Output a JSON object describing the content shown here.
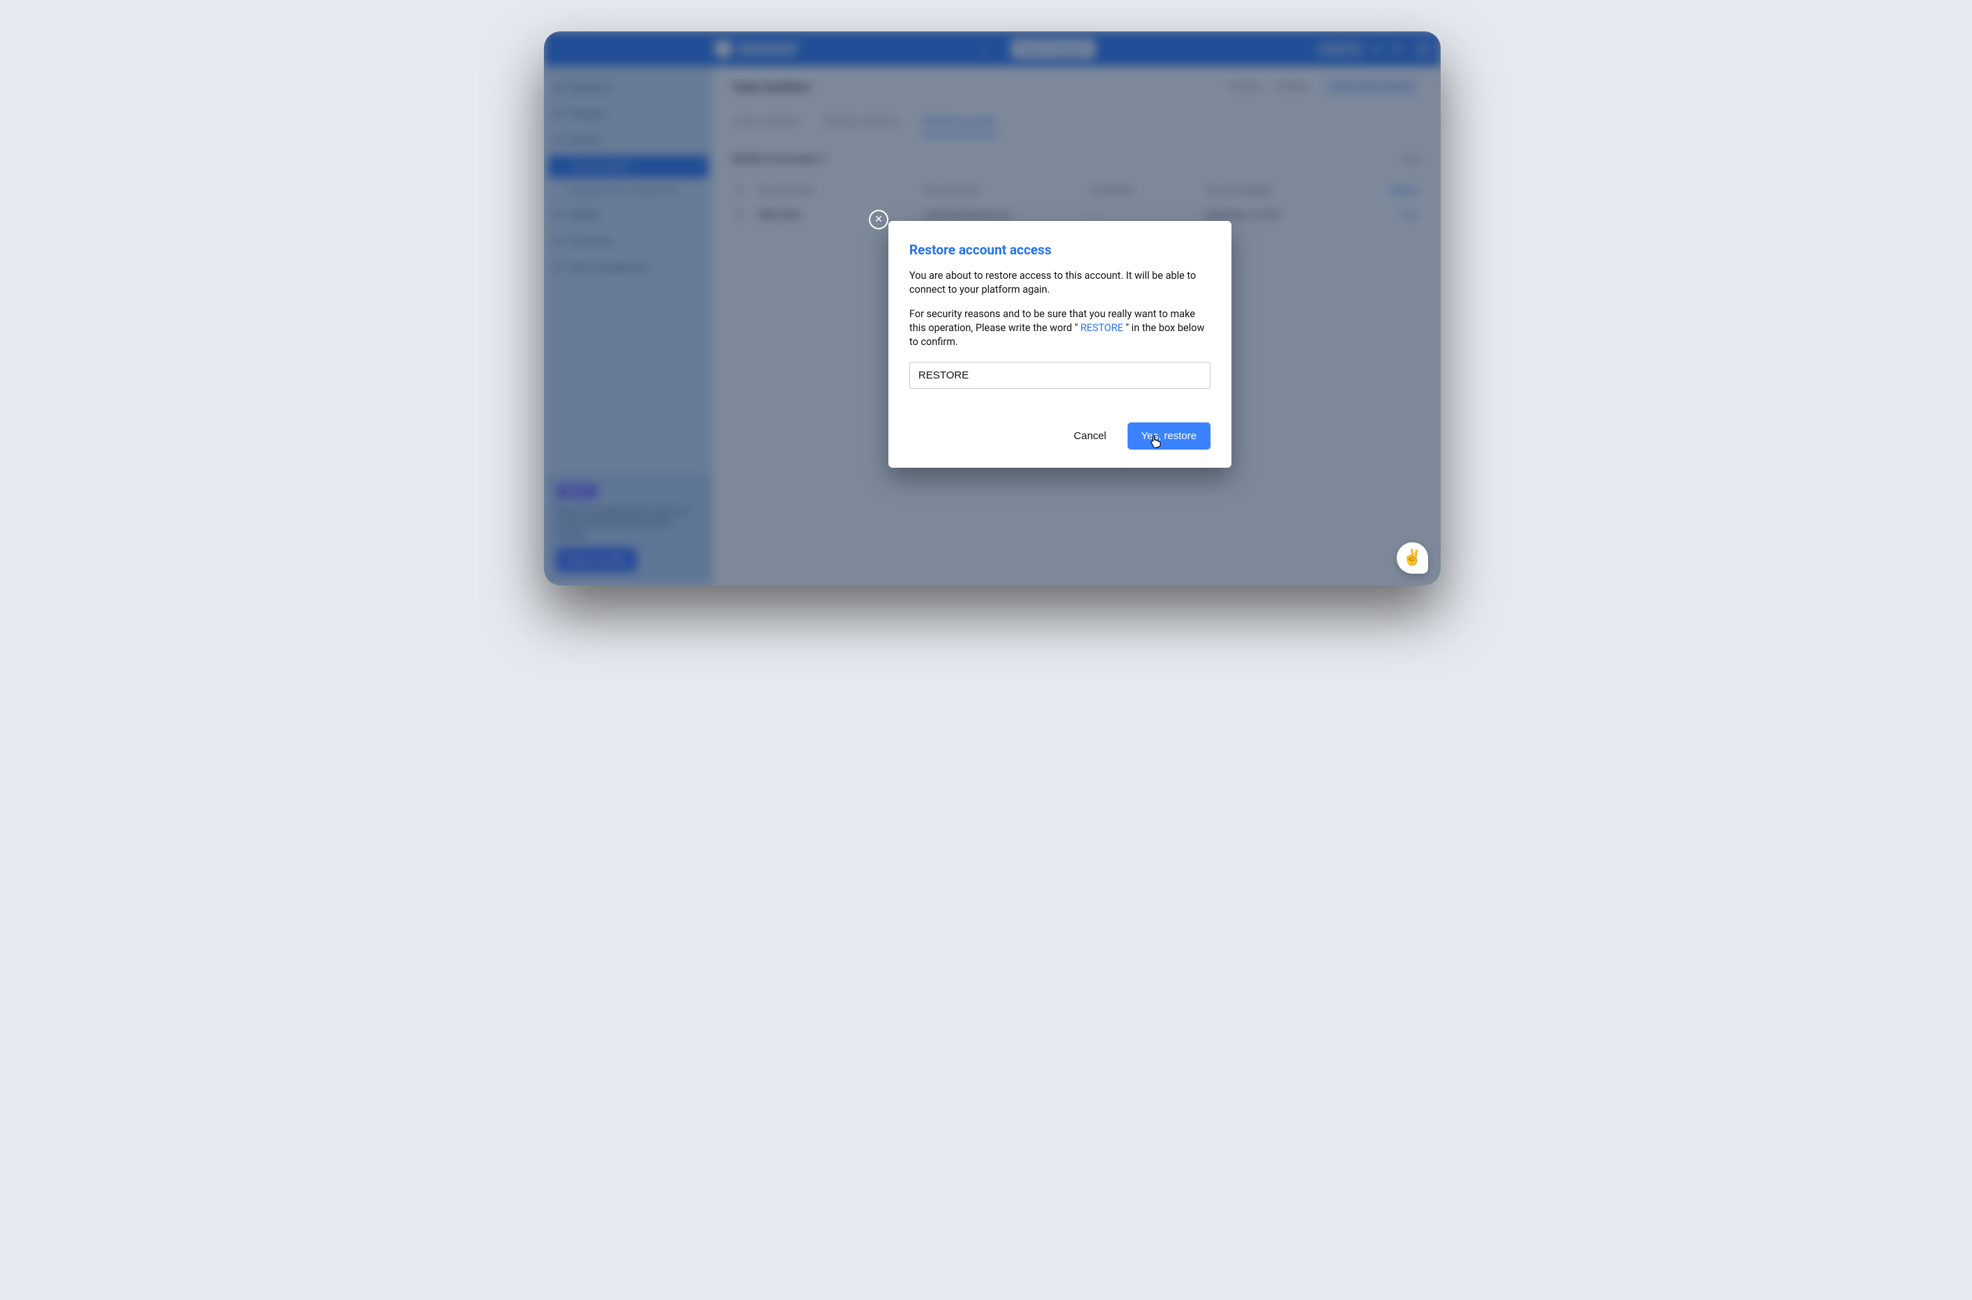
{
  "header": {
    "browse_btn": "Browse workspace",
    "lang": "English"
  },
  "sidebar": {
    "items": [
      {
        "label": "Dashboard"
      },
      {
        "label": "Programs"
      },
      {
        "label": "Security",
        "children": [
          {
            "label": "Team members"
          },
          {
            "label": "Challenge team management"
          }
        ]
      },
      {
        "label": "Settings"
      },
      {
        "label": "Activity log"
      },
      {
        "label": "Token management"
      }
    ],
    "promo": {
      "badge": "PARTLY",
      "text": "We are accumulating plans. Save up to $1,000 annually by paying upfront annually.",
      "cta": "Review my offer"
    }
  },
  "main": {
    "title": "Team members",
    "sort": "Sort",
    "filters": "Filters",
    "invite": "Invite a team member",
    "tabs": [
      "Active members",
      "Pending invitations",
      "Blocked accounts"
    ],
    "subheader": "Number of accounts: 2",
    "view": "View",
    "columns": [
      "Account name",
      "Account email",
      "Credentials",
      "Account disabled",
      "Actions"
    ],
    "rows": [
      {
        "name": "Marie Alice",
        "email": "marie.a@example.com",
        "credentials": "—",
        "disabled": "September 10, 2022",
        "action": "View"
      }
    ]
  },
  "modal": {
    "title": "Restore account access",
    "p1": "You are about to restore access to this account. It will be able to connect to your platform again.",
    "p2_a": "For security reasons and to be sure that you really want to make this operation, Please write the word \" ",
    "p2_keyword": "RESTORE",
    "p2_b": " \" in the box below to confirm.",
    "input_value": "RESTORE",
    "cancel": "Cancel",
    "confirm": "Yes, restore"
  },
  "chat_emoji": "✌️"
}
